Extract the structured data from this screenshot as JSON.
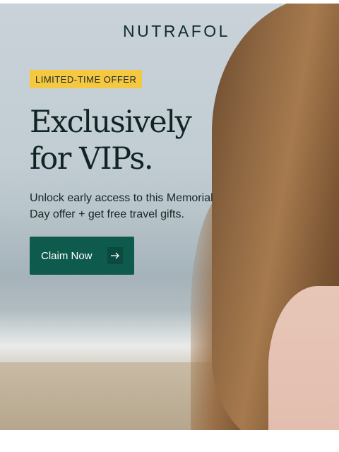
{
  "brand": {
    "logo": "NUTRAFOL"
  },
  "hero": {
    "badge": "LIMITED-TIME OFFER",
    "headline_line1": "Exclusively",
    "headline_line2": "for VIPs.",
    "subtext": "Unlock early access to this Memorial Day offer + get free travel gifts.",
    "cta_label": "Claim Now",
    "cta_icon": "arrow-right-icon"
  },
  "colors": {
    "brand_green": "#0e5a4c",
    "badge_yellow": "#f5c842",
    "text_dark": "#0f2523"
  }
}
